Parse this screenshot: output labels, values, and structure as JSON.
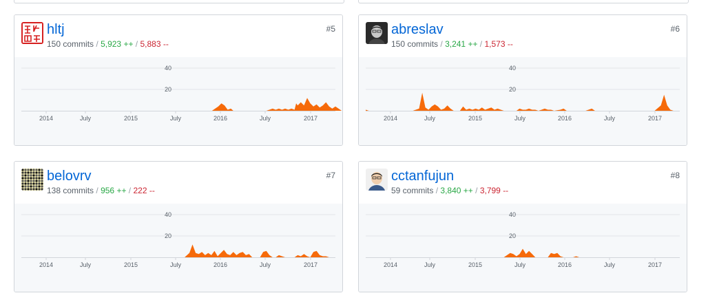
{
  "stats_sep": "/",
  "add_suffix": "++",
  "del_suffix": "--",
  "colors": {
    "area": "#f66a0a",
    "link": "#0366d6",
    "add": "#28a745",
    "del": "#cb2431"
  },
  "contributors": [
    {
      "login": "hltj",
      "rank": "#5",
      "commits": "150 commits",
      "additions": "5,923",
      "deletions": "5,883",
      "avatar_icon": "red-seal-avatar",
      "chart_data": {
        "type": "area",
        "y_ticks": [
          20,
          40
        ],
        "ylim": [
          0,
          50
        ],
        "x_ticks": [
          "2014",
          "July",
          "2015",
          "July",
          "2016",
          "July",
          "2017"
        ],
        "points": [
          [
            0.607,
            0
          ],
          [
            0.627,
            4
          ],
          [
            0.637,
            7
          ],
          [
            0.647,
            5
          ],
          [
            0.657,
            1
          ],
          [
            0.667,
            2
          ],
          [
            0.675,
            0
          ],
          [
            0.78,
            0
          ],
          [
            0.79,
            1
          ],
          [
            0.8,
            2
          ],
          [
            0.81,
            1
          ],
          [
            0.82,
            2
          ],
          [
            0.83,
            1
          ],
          [
            0.84,
            2
          ],
          [
            0.85,
            1
          ],
          [
            0.86,
            2
          ],
          [
            0.87,
            1
          ],
          [
            0.875,
            7
          ],
          [
            0.88,
            5
          ],
          [
            0.89,
            8
          ],
          [
            0.9,
            5
          ],
          [
            0.91,
            12
          ],
          [
            0.92,
            7
          ],
          [
            0.93,
            4
          ],
          [
            0.94,
            6
          ],
          [
            0.95,
            3
          ],
          [
            0.96,
            5
          ],
          [
            0.97,
            8
          ],
          [
            0.98,
            4
          ],
          [
            0.99,
            2
          ],
          [
            1.0,
            4
          ],
          [
            1.01,
            2
          ],
          [
            1.02,
            0
          ]
        ]
      }
    },
    {
      "login": "abreslav",
      "rank": "#6",
      "commits": "150 commits",
      "additions": "3,241",
      "deletions": "1,573",
      "avatar_icon": "person-photo-avatar",
      "chart_data": {
        "type": "area",
        "y_ticks": [
          20,
          40
        ],
        "ylim": [
          0,
          50
        ],
        "x_ticks": [
          "2014",
          "July",
          "2015",
          "July",
          "2016",
          "July",
          "2017"
        ],
        "points": [
          [
            0.0,
            1
          ],
          [
            0.01,
            0
          ],
          [
            0.15,
            0
          ],
          [
            0.17,
            2
          ],
          [
            0.18,
            17
          ],
          [
            0.19,
            3
          ],
          [
            0.2,
            1
          ],
          [
            0.21,
            4
          ],
          [
            0.22,
            6
          ],
          [
            0.23,
            4
          ],
          [
            0.24,
            1
          ],
          [
            0.25,
            2
          ],
          [
            0.26,
            5
          ],
          [
            0.27,
            2
          ],
          [
            0.28,
            0
          ],
          [
            0.3,
            0
          ],
          [
            0.31,
            4
          ],
          [
            0.32,
            1
          ],
          [
            0.33,
            2
          ],
          [
            0.34,
            1
          ],
          [
            0.35,
            2
          ],
          [
            0.36,
            1
          ],
          [
            0.37,
            3
          ],
          [
            0.38,
            1
          ],
          [
            0.39,
            2
          ],
          [
            0.4,
            3
          ],
          [
            0.41,
            1
          ],
          [
            0.42,
            2
          ],
          [
            0.43,
            1
          ],
          [
            0.44,
            0
          ],
          [
            0.48,
            0
          ],
          [
            0.49,
            2
          ],
          [
            0.5,
            1
          ],
          [
            0.51,
            1
          ],
          [
            0.52,
            2
          ],
          [
            0.53,
            1
          ],
          [
            0.54,
            1
          ],
          [
            0.55,
            0
          ],
          [
            0.56,
            1
          ],
          [
            0.57,
            2
          ],
          [
            0.58,
            1
          ],
          [
            0.59,
            1
          ],
          [
            0.6,
            0
          ],
          [
            0.62,
            1
          ],
          [
            0.63,
            2
          ],
          [
            0.64,
            0
          ],
          [
            0.7,
            0
          ],
          [
            0.72,
            2
          ],
          [
            0.73,
            0
          ],
          [
            0.92,
            0
          ],
          [
            0.94,
            5
          ],
          [
            0.95,
            15
          ],
          [
            0.96,
            5
          ],
          [
            0.97,
            1
          ],
          [
            0.98,
            0
          ]
        ]
      }
    },
    {
      "login": "belovrv",
      "rank": "#7",
      "commits": "138 commits",
      "additions": "956",
      "deletions": "222",
      "avatar_icon": "dot-pattern-avatar",
      "chart_data": {
        "type": "area",
        "y_ticks": [
          20,
          40
        ],
        "ylim": [
          0,
          50
        ],
        "x_ticks": [
          "2014",
          "July",
          "2015",
          "July",
          "2016",
          "July",
          "2017"
        ],
        "points": [
          [
            0.52,
            0
          ],
          [
            0.535,
            4
          ],
          [
            0.545,
            12
          ],
          [
            0.555,
            4
          ],
          [
            0.565,
            3
          ],
          [
            0.575,
            5
          ],
          [
            0.585,
            2
          ],
          [
            0.595,
            4
          ],
          [
            0.605,
            2
          ],
          [
            0.615,
            6
          ],
          [
            0.625,
            1
          ],
          [
            0.635,
            4
          ],
          [
            0.645,
            7
          ],
          [
            0.655,
            3
          ],
          [
            0.665,
            2
          ],
          [
            0.675,
            5
          ],
          [
            0.685,
            2
          ],
          [
            0.695,
            4
          ],
          [
            0.705,
            5
          ],
          [
            0.715,
            2
          ],
          [
            0.725,
            3
          ],
          [
            0.735,
            0
          ],
          [
            0.76,
            0
          ],
          [
            0.77,
            5
          ],
          [
            0.78,
            6
          ],
          [
            0.79,
            2
          ],
          [
            0.8,
            0
          ],
          [
            0.81,
            0
          ],
          [
            0.82,
            2
          ],
          [
            0.83,
            1
          ],
          [
            0.84,
            0
          ],
          [
            0.87,
            0
          ],
          [
            0.88,
            2
          ],
          [
            0.89,
            1
          ],
          [
            0.9,
            3
          ],
          [
            0.91,
            1
          ],
          [
            0.92,
            0
          ],
          [
            0.93,
            5
          ],
          [
            0.94,
            6
          ],
          [
            0.95,
            2
          ],
          [
            0.96,
            1
          ],
          [
            0.97,
            1
          ],
          [
            0.98,
            0
          ]
        ]
      }
    },
    {
      "login": "cctanfujun",
      "rank": "#8",
      "commits": "59 commits",
      "additions": "3,840",
      "deletions": "3,799",
      "avatar_icon": "person-photo-avatar",
      "chart_data": {
        "type": "area",
        "y_ticks": [
          20,
          40
        ],
        "ylim": [
          0,
          50
        ],
        "x_ticks": [
          "2014",
          "July",
          "2015",
          "July",
          "2016",
          "July",
          "2017"
        ],
        "points": [
          [
            0.44,
            0
          ],
          [
            0.46,
            4
          ],
          [
            0.47,
            3
          ],
          [
            0.48,
            1
          ],
          [
            0.49,
            3
          ],
          [
            0.5,
            8
          ],
          [
            0.51,
            3
          ],
          [
            0.52,
            6
          ],
          [
            0.53,
            3
          ],
          [
            0.54,
            0
          ],
          [
            0.56,
            0
          ],
          [
            0.58,
            0
          ],
          [
            0.59,
            4
          ],
          [
            0.6,
            3
          ],
          [
            0.61,
            4
          ],
          [
            0.62,
            1
          ],
          [
            0.63,
            0
          ],
          [
            0.66,
            0
          ],
          [
            0.67,
            1
          ],
          [
            0.68,
            0
          ]
        ]
      }
    }
  ]
}
